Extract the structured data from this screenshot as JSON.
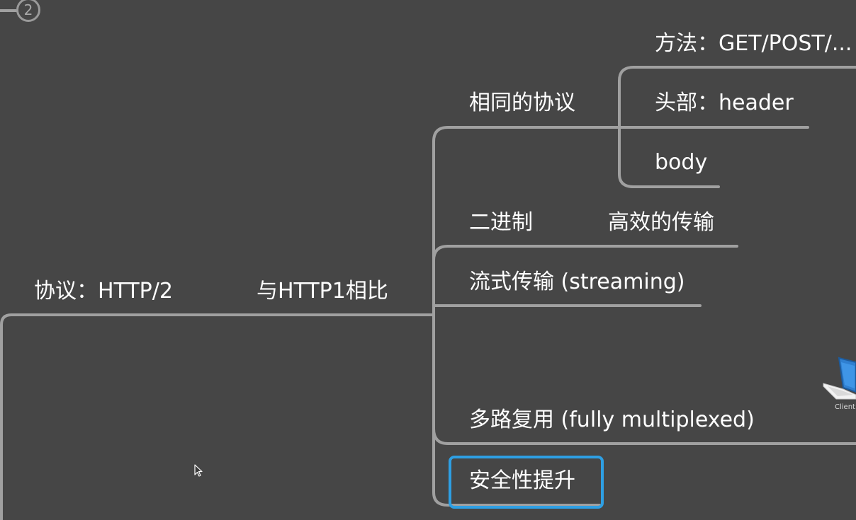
{
  "step_badge": "2",
  "root": {
    "label": "协议：HTTP/2",
    "compare_label": "与HTTP1相比"
  },
  "branches": {
    "same_protocol": {
      "label": "相同的协议",
      "children": {
        "method": "方法：GET/POST/...",
        "header": "头部：header",
        "body": "body"
      }
    },
    "binary": {
      "label": "二进制",
      "note": "高效的传输"
    },
    "streaming": "流式传输 (streaming)",
    "multiplexed": "多路复用 (fully multiplexed)",
    "security": "安全性提升"
  },
  "client_label": "Client",
  "colors": {
    "background": "#464646",
    "connector": "#a0a0a0",
    "text": "#ffffff",
    "highlight": "#2e9fe3"
  }
}
